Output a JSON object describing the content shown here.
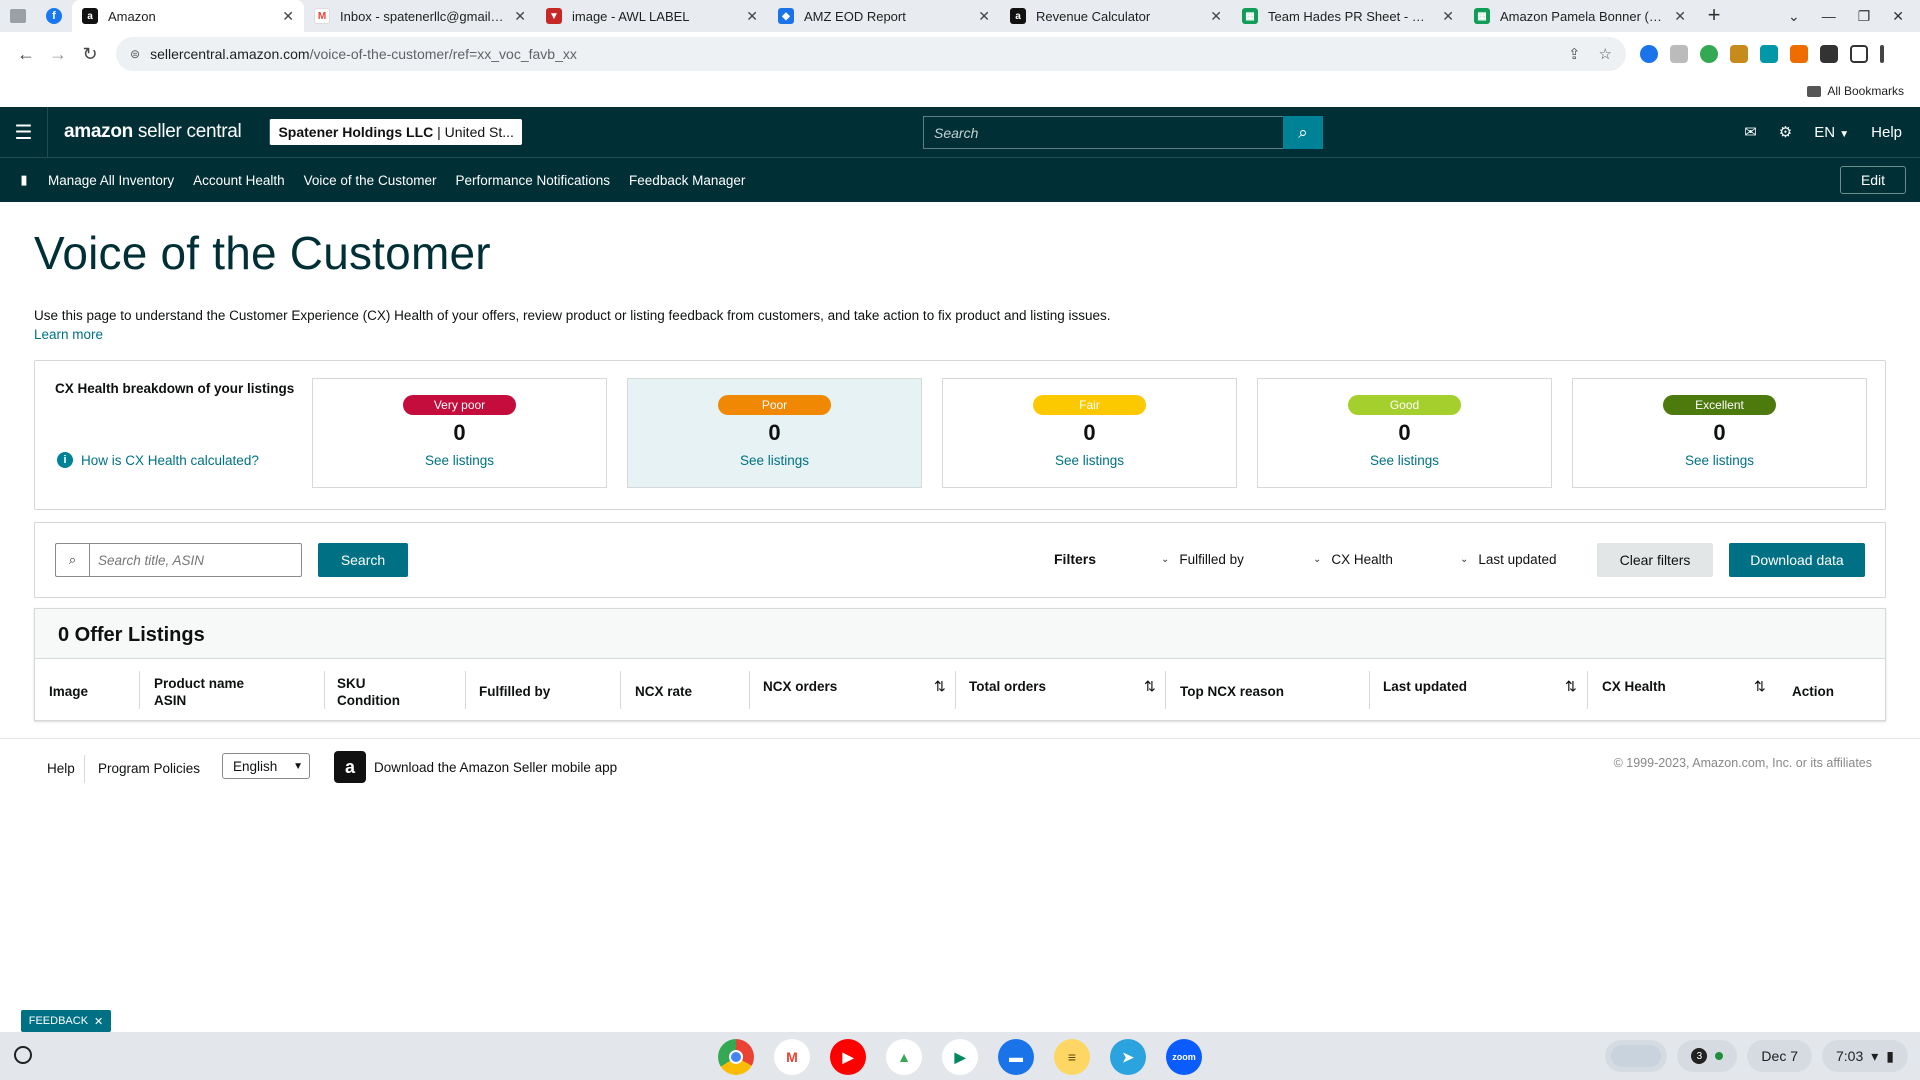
{
  "browser": {
    "tabs": [
      {
        "title": "",
        "icon": "apps-icon",
        "color": "#9aa0a6"
      },
      {
        "title": "",
        "icon": "facebook-icon",
        "color": "#1877f2"
      },
      {
        "title": "Amazon",
        "icon": "amazon-icon",
        "color": "#111111"
      },
      {
        "title": "Inbox - spatenerllc@gmail.com",
        "icon": "gmail-icon",
        "color": "#ea4335"
      },
      {
        "title": "image - AWL LABEL",
        "icon": "awl-icon",
        "color": "#c62828"
      },
      {
        "title": "AMZ EOD Report",
        "icon": "report-icon",
        "color": "#1a73e8"
      },
      {
        "title": "Revenue Calculator",
        "icon": "amazon-icon",
        "color": "#111111"
      },
      {
        "title": "Team Hades PR Sheet - Google",
        "icon": "sheets-icon",
        "color": "#0f9d58"
      },
      {
        "title": "Amazon Pamela Bonner (Dr B",
        "icon": "sheets-icon",
        "color": "#0f9d58"
      }
    ],
    "url_host": "sellercentral.amazon.com",
    "url_path": "/voice-of-the-customer/ref=xx_voc_favb_xx",
    "bookmarks_label": "All Bookmarks"
  },
  "header": {
    "logo_bold": "amazon",
    "logo_light": " seller central",
    "account_name": "Spatener Holdings LLC",
    "account_region": " | United St...",
    "search_placeholder": "Search",
    "language": "EN",
    "help": "Help"
  },
  "subnav": {
    "items": [
      "Manage All Inventory",
      "Account Health",
      "Voice of the Customer",
      "Performance Notifications",
      "Feedback Manager"
    ],
    "edit": "Edit"
  },
  "page": {
    "title": "Voice of the Customer",
    "description": "Use this page to understand the Customer Experience (CX) Health of your offers, review product or listing feedback from customers, and take action to fix product and listing issues.",
    "learn_more": "Learn more"
  },
  "cx_health": {
    "title": "CX Health breakdown of your listings",
    "how_link": "How is CX Health calculated?",
    "categories": [
      {
        "label": "Very poor",
        "count": "0",
        "link": "See listings",
        "color": "#c40d3c"
      },
      {
        "label": "Poor",
        "count": "0",
        "link": "See listings",
        "color": "#f08804"
      },
      {
        "label": "Fair",
        "count": "0",
        "link": "See listings",
        "color": "#fcc900"
      },
      {
        "label": "Good",
        "count": "0",
        "link": "See listings",
        "color": "#a5cf2c"
      },
      {
        "label": "Excellent",
        "count": "0",
        "link": "See listings",
        "color": "#4d7a0c"
      }
    ]
  },
  "filters": {
    "search_placeholder": "Search title, ASIN",
    "search_button": "Search",
    "label": "Filters",
    "fulfilled_by": "Fulfilled by",
    "cx_health": "CX Health",
    "last_updated": "Last updated",
    "clear": "Clear filters",
    "download": "Download data"
  },
  "listings": {
    "heading": "0 Offer Listings",
    "columns": {
      "image": "Image",
      "product_name": "Product name",
      "asin": "ASIN",
      "sku": "SKU",
      "condition": "Condition",
      "fulfilled_by": "Fulfilled by",
      "ncx_rate": "NCX rate",
      "ncx_orders": "NCX orders",
      "total_orders": "Total orders",
      "top_ncx_reason": "Top NCX reason",
      "last_updated": "Last updated",
      "cx_health": "CX Health",
      "action": "Action"
    }
  },
  "footer": {
    "help": "Help",
    "policies": "Program Policies",
    "language": "English",
    "app_link": "Download the Amazon Seller mobile app",
    "copyright": "© 1999-2023, Amazon.com, Inc. or its affiliates"
  },
  "feedback_tab": "FEEDBACK",
  "os": {
    "date": "Dec 7",
    "time": "7:03",
    "notification_count": "3"
  }
}
